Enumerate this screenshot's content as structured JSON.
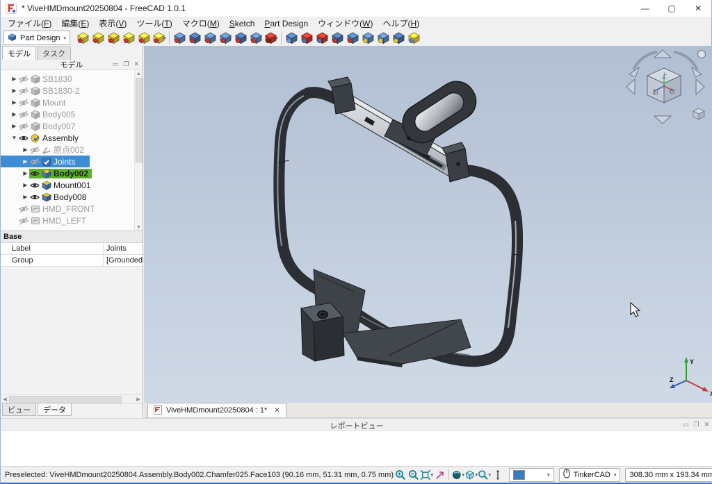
{
  "window": {
    "title": "* ViveHMDmount20250804 - FreeCAD 1.0.1",
    "minimize": "—",
    "maximize": "▢",
    "close": "✕"
  },
  "menubar": {
    "items": [
      {
        "label": "ファイル(F)",
        "key": "F"
      },
      {
        "label": "編集(E)",
        "key": "E"
      },
      {
        "label": "表示(V)",
        "key": "V"
      },
      {
        "label": "ツール(T)",
        "key": "T"
      },
      {
        "label": "マクロ(M)",
        "key": "M"
      },
      {
        "label": "Sketch",
        "key": "S"
      },
      {
        "label": "Part Design",
        "key": "P"
      },
      {
        "label": "ウィンドウ(W)",
        "key": "W"
      },
      {
        "label": "ヘルプ(H)",
        "key": "H"
      }
    ]
  },
  "toolbar": {
    "workbench": {
      "label": "Part Design",
      "icon": "workbench-cube-icon",
      "color": "#3a6db5"
    },
    "groups": [
      {
        "icons": [
          {
            "name": "pad-icon",
            "main": "#ecd24a",
            "accent": "#c4392e"
          },
          {
            "name": "revolution-icon",
            "main": "#e9c93f",
            "accent": "#c4392e"
          },
          {
            "name": "additive-loft-icon",
            "main": "#e5b83a",
            "accent": "#c4392e"
          },
          {
            "name": "additive-pipe-icon",
            "main": "#ecd24a",
            "accent": "#c4392e"
          },
          {
            "name": "additive-helix-icon",
            "main": "#e9c93f",
            "accent": "#c4392e"
          },
          {
            "name": "additive-primitive-icon",
            "main": "#ecd24a",
            "accent": "#c4392e",
            "dropdown": true
          }
        ]
      },
      {
        "icons": [
          {
            "name": "pocket-icon",
            "main": "#5f87b8",
            "accent": "#c4392e"
          },
          {
            "name": "hole-icon",
            "main": "#4a6fa5",
            "accent": "#c4392e"
          },
          {
            "name": "groove-icon",
            "main": "#5f87b8",
            "accent": "#c4392e"
          },
          {
            "name": "subtractive-loft-icon",
            "main": "#5f87b8",
            "accent": "#c4392e"
          },
          {
            "name": "subtractive-pipe-icon",
            "main": "#4a6fa5",
            "accent": "#c4392e"
          },
          {
            "name": "subtractive-helix-icon",
            "main": "#5f87b8",
            "accent": "#c4392e"
          },
          {
            "name": "subtractive-primitive-icon",
            "main": "#c4392e",
            "accent": "#8a1f18",
            "dropdown": true
          }
        ]
      },
      {
        "icons": [
          {
            "name": "fillet-icon",
            "main": "#4f7bb0",
            "accent": "#6fa0d6"
          },
          {
            "name": "chamfer-icon",
            "main": "#c4392e",
            "accent": "#4f7bb0"
          },
          {
            "name": "draft-icon",
            "main": "#c4392e",
            "accent": "#4f7bb0"
          },
          {
            "name": "thickness-icon",
            "main": "#4a6fa5",
            "accent": "#c4392e"
          },
          {
            "name": "boolean-icon",
            "main": "#4f7bb0",
            "accent": "#c4392e"
          },
          {
            "name": "mirrored-icon",
            "main": "#5f87b8",
            "accent": "#e8c93e"
          },
          {
            "name": "linear-pattern-icon",
            "main": "#5f87b8",
            "accent": "#e8c93e"
          },
          {
            "name": "polar-pattern-icon",
            "main": "#4a6fa5",
            "accent": "#e8c93e"
          },
          {
            "name": "multitransform-icon",
            "main": "#e8c93e",
            "accent": "#5f87b8"
          }
        ]
      }
    ]
  },
  "combo_view": {
    "tabs": [
      {
        "label": "モデル",
        "active": true
      },
      {
        "label": "タスク",
        "active": false
      }
    ],
    "header": {
      "title": "モデル",
      "buttons": [
        "▭",
        "❐",
        "✕"
      ]
    },
    "tree": [
      {
        "label": "SB1830",
        "level": 0,
        "arrow": "right",
        "eye": "hidden",
        "icon": "body-gray"
      },
      {
        "label": "SB1830-2",
        "level": 0,
        "arrow": "right",
        "eye": "hidden",
        "icon": "body-gray"
      },
      {
        "label": "Mount",
        "level": 0,
        "arrow": "right",
        "eye": "hidden",
        "icon": "body-gray"
      },
      {
        "label": "Body005",
        "level": 0,
        "arrow": "right",
        "eye": "hidden",
        "icon": "body-gray"
      },
      {
        "label": "Body007",
        "level": 0,
        "arrow": "right",
        "eye": "hidden",
        "icon": "body-gray"
      },
      {
        "label": "Assembly",
        "level": 0,
        "arrow": "down",
        "eye": "visible",
        "icon": "assembly"
      },
      {
        "label": "原点002",
        "level": 1,
        "arrow": "right",
        "eye": "hidden",
        "icon": "origin"
      },
      {
        "label": "Joints",
        "level": 1,
        "arrow": "right",
        "eye": "hidden",
        "icon": "joints",
        "selected": true
      },
      {
        "label": "Body002",
        "level": 1,
        "arrow": "right",
        "eye": "visible",
        "icon": "body",
        "highlight": true
      },
      {
        "label": "Mount001",
        "level": 1,
        "arrow": "right",
        "eye": "visible",
        "icon": "body"
      },
      {
        "label": "Body008",
        "level": 1,
        "arrow": "right",
        "eye": "visible",
        "icon": "body"
      },
      {
        "label": "HMD_FRONT",
        "level": 0,
        "arrow": "none",
        "eye": "hidden",
        "icon": "sketch-gray"
      },
      {
        "label": "HMD_LEFT",
        "level": 0,
        "arrow": "none",
        "eye": "hidden",
        "icon": "sketch-gray"
      }
    ],
    "properties": {
      "section": "Base",
      "rows": [
        {
          "name": "Label",
          "value": "Joints"
        },
        {
          "name": "Group",
          "value": "[Grounded"
        }
      ]
    },
    "bottom_tabs": [
      {
        "label": "ビュー",
        "active": false
      },
      {
        "label": "データ",
        "active": true
      }
    ]
  },
  "viewport": {
    "nav_cube": {
      "top": "上",
      "front": "前",
      "right": "右"
    },
    "axis": {
      "x": "X",
      "y": "Y",
      "z": "Z"
    },
    "background_top": "#b2bfd3",
    "background_bottom": "#cfd9e6",
    "model_color": "#33373c"
  },
  "document_tabs": [
    {
      "label": "ViveHMDmount20250804 : 1*",
      "close": "✕",
      "active": true
    }
  ],
  "report_view": {
    "title": "レポートビュー",
    "buttons": [
      "▭",
      "❐",
      "✕"
    ]
  },
  "statusbar": {
    "message": "Preselected: ViveHMDmount20250804.Assembly.Body002.Chamfer025.Face103 (90.16 mm, 51.31 mm, 0.75 mm)",
    "tools": [
      {
        "name": "zoom-in-icon"
      },
      {
        "name": "zoom-out-icon"
      },
      {
        "name": "fit-all-icon",
        "dropdown": true
      },
      {
        "name": "sync-view-icon"
      },
      {
        "name": "separator"
      },
      {
        "name": "draw-style-icon",
        "dropdown": true
      },
      {
        "name": "view-isometric-icon",
        "dropdown": true
      },
      {
        "name": "zoom-tool-icon",
        "dropdown": true
      },
      {
        "name": "measure-icon"
      }
    ],
    "color_swatch": "#3a7cc2",
    "navigation_style": "TinkerCAD",
    "dimensions": "308.30 mm x 193.34 mm"
  }
}
